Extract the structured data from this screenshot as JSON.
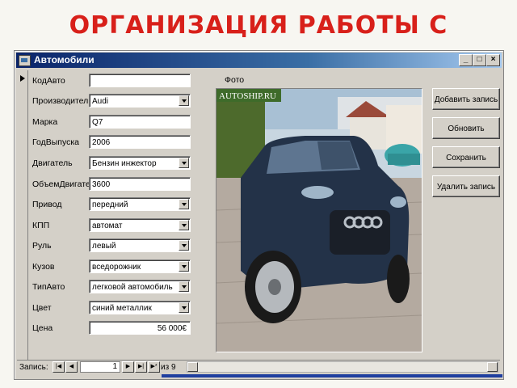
{
  "slide": {
    "title": "ОРГАНИЗАЦИЯ РАБОТЫ С"
  },
  "window": {
    "title": "Автомобили",
    "controls": {
      "minimize": "_",
      "maximize": "□",
      "close": "×"
    }
  },
  "form": {
    "fields": [
      {
        "label": "КодАвто",
        "value": "",
        "type": "text"
      },
      {
        "label": "Производитель",
        "value": "Audi",
        "type": "combo"
      },
      {
        "label": "Марка",
        "value": "Q7",
        "type": "text"
      },
      {
        "label": "ГодВыпуска",
        "value": "2006",
        "type": "text"
      },
      {
        "label": "Двигатель",
        "value": "Бензин инжектор",
        "type": "combo"
      },
      {
        "label": "ОбъемДвигате",
        "value": "3600",
        "type": "text"
      },
      {
        "label": "Привод",
        "value": "передний",
        "type": "combo"
      },
      {
        "label": "КПП",
        "value": "автомат",
        "type": "combo"
      },
      {
        "label": "Руль",
        "value": "левый",
        "type": "combo"
      },
      {
        "label": "Кузов",
        "value": "вседорожник",
        "type": "combo"
      },
      {
        "label": "ТипАвто",
        "value": "легковой автомобиль",
        "type": "combo"
      },
      {
        "label": "Цвет",
        "value": "синий металлик",
        "type": "combo"
      },
      {
        "label": "Цена",
        "value": "56 000€",
        "type": "text"
      }
    ],
    "photo_label": "Фото",
    "photo_watermark": "AUTOSHIP.RU",
    "buttons": {
      "add": "Добавить запись",
      "refresh": "Обновить",
      "save": "Сохранить запись",
      "delete": "Удалить запись"
    }
  },
  "navigation": {
    "label": "Запись:",
    "current": "1",
    "of_label": "из",
    "total": "9"
  },
  "colors": {
    "title": "#d8201a",
    "titlebar": "#0a246a",
    "accent_line": "#1f3f9f"
  }
}
